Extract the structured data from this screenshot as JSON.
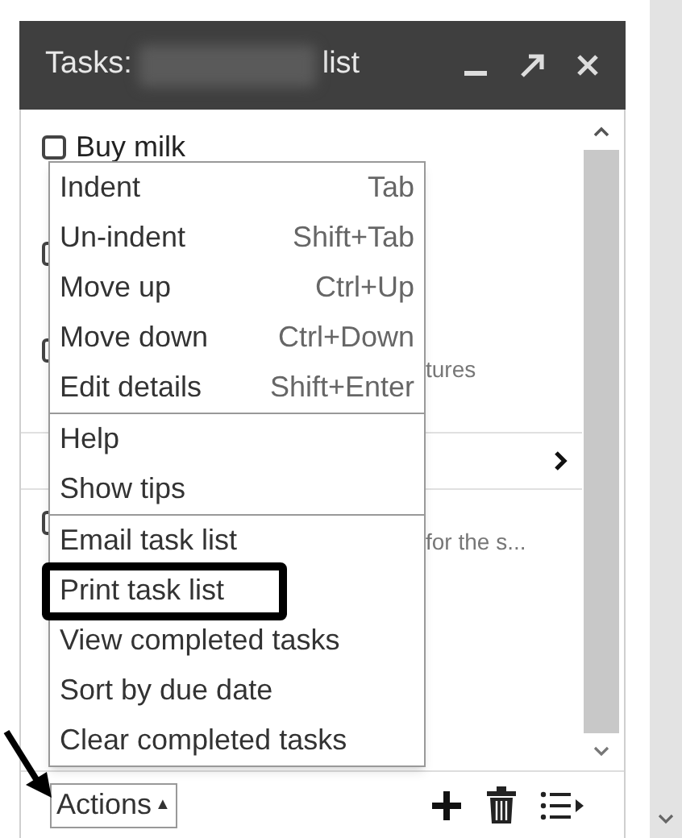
{
  "window": {
    "title_prefix": "Tasks:",
    "title_suffix": "list"
  },
  "tasks": [
    {
      "title": "Buy milk",
      "checked": false
    },
    {
      "partly_hidden": true
    },
    {
      "partly_hidden": true,
      "note": "tures"
    },
    {
      "partly_hidden": true,
      "note": "for the s..."
    }
  ],
  "menu": {
    "sections": [
      {
        "items": [
          {
            "label": "Indent",
            "shortcut": "Tab",
            "annotated": false
          },
          {
            "label": "Un-indent",
            "shortcut": "Shift+Tab",
            "annotated": false
          },
          {
            "label": "Move up",
            "shortcut": "Ctrl+Up",
            "annotated": false
          },
          {
            "label": "Move down",
            "shortcut": "Ctrl+Down",
            "annotated": false
          },
          {
            "label": "Edit details",
            "shortcut": "Shift+Enter",
            "annotated": false
          }
        ]
      },
      {
        "items": [
          {
            "label": "Help",
            "annotated": false
          },
          {
            "label": "Show tips",
            "annotated": false
          }
        ]
      },
      {
        "items": [
          {
            "label": "Email task list",
            "annotated": false
          },
          {
            "label": "Print task list",
            "annotated": true
          },
          {
            "label": "View completed tasks",
            "annotated": false
          },
          {
            "label": "Sort by due date",
            "annotated": false
          },
          {
            "label": "Clear completed tasks",
            "annotated": false
          }
        ]
      }
    ]
  },
  "footer": {
    "actions_button": "Actions",
    "actions_caret": "▲"
  }
}
